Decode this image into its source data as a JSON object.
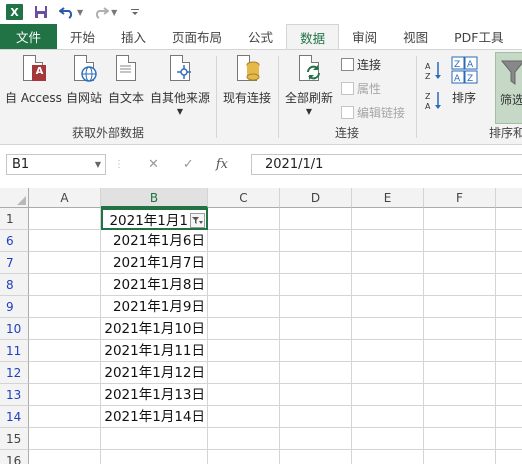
{
  "quick_access": {
    "app_icon_letter": "X"
  },
  "tabs": [
    {
      "label": "文件",
      "active": false
    },
    {
      "label": "开始",
      "active": false
    },
    {
      "label": "插入",
      "active": false
    },
    {
      "label": "页面布局",
      "active": false
    },
    {
      "label": "公式",
      "active": false
    },
    {
      "label": "数据",
      "active": true
    },
    {
      "label": "审阅",
      "active": false
    },
    {
      "label": "视图",
      "active": false
    },
    {
      "label": "PDF工具",
      "active": false
    }
  ],
  "ribbon": {
    "groups": {
      "external": {
        "label": "获取外部数据",
        "buttons": {
          "access": "自 Access",
          "web": "自网站",
          "text": "自文本",
          "other": "自其他来源"
        }
      },
      "existing": {
        "label": "现有连接"
      },
      "connections": {
        "label": "连接",
        "refresh_all": "全部刷新",
        "connections": "连接",
        "properties": "属性",
        "edit_links": "编辑链接"
      },
      "sort_filter": {
        "label": "排序和",
        "sort": "排序",
        "filter": "筛选"
      }
    }
  },
  "formula_bar": {
    "name_box": "B1",
    "cancel": "✕",
    "enter": "✓",
    "fx": "fx",
    "value": "2021/1/1"
  },
  "grid": {
    "columns": [
      "A",
      "B",
      "C",
      "D",
      "E",
      "F"
    ],
    "selected_column": "B",
    "rows": [
      {
        "num": "1",
        "filtered": false,
        "b": "2021年1月1"
      },
      {
        "num": "6",
        "filtered": true,
        "b": "2021年1月6日"
      },
      {
        "num": "7",
        "filtered": true,
        "b": "2021年1月7日"
      },
      {
        "num": "8",
        "filtered": true,
        "b": "2021年1月8日"
      },
      {
        "num": "9",
        "filtered": true,
        "b": "2021年1月9日"
      },
      {
        "num": "10",
        "filtered": true,
        "b": "2021年1月10日"
      },
      {
        "num": "11",
        "filtered": true,
        "b": "2021年1月11日"
      },
      {
        "num": "12",
        "filtered": true,
        "b": "2021年1月12日"
      },
      {
        "num": "13",
        "filtered": true,
        "b": "2021年1月13日"
      },
      {
        "num": "14",
        "filtered": true,
        "b": "2021年1月14日"
      },
      {
        "num": "15",
        "filtered": false,
        "b": ""
      },
      {
        "num": "16",
        "filtered": false,
        "b": ""
      }
    ]
  }
}
